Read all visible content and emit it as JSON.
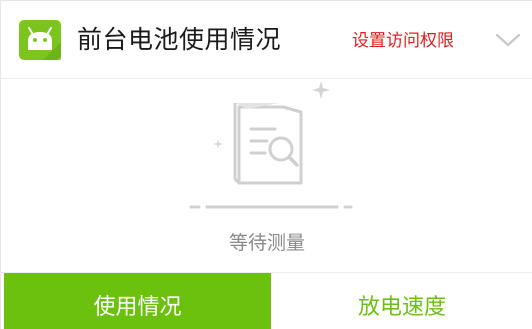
{
  "header": {
    "title": "前台电池使用情况",
    "permission_link": "设置访问权限",
    "app_icon": "android-icon",
    "expand_icon": "chevron-down-icon"
  },
  "empty_state": {
    "icon": "document-search-icon",
    "status": "等待测量"
  },
  "tabs": [
    {
      "label": "使用情况",
      "active": true
    },
    {
      "label": "放电速度",
      "active": false
    }
  ],
  "colors": {
    "accent_green": "#6cc10f",
    "link_red": "#e02020",
    "muted_gray": "#8a8a8a"
  }
}
